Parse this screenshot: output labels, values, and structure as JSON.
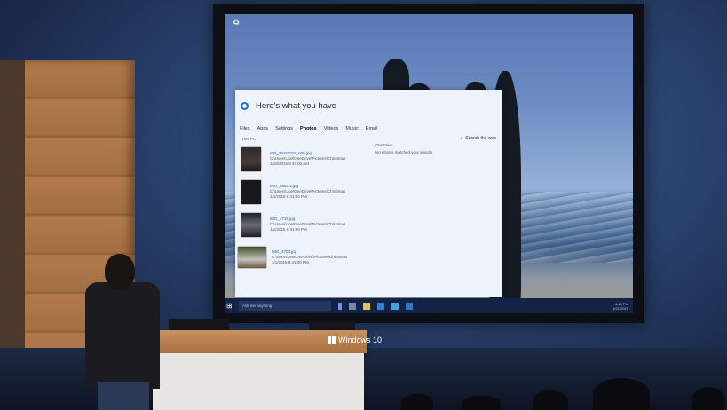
{
  "desktop": {
    "icon_label": "Recycle Bin"
  },
  "search_panel": {
    "title": "Here's what you have",
    "tabs": [
      "Files",
      "Apps",
      "Settings",
      "Photos",
      "Videos",
      "Music",
      "Email"
    ],
    "active_tab": "Photos",
    "search_web_label": "Search the web",
    "this_pc_label": "This PC",
    "onedrive_label": "OneDrive",
    "onedrive_empty": "No photos matched your search.",
    "results": [
      {
        "name": "WP_20150318_026.jpg",
        "path": "C:\\Users\\Joe\\OneDrive\\Pictures\\Christmas",
        "date": "1/18/2015 8:40:00 AM"
      },
      {
        "name": "IMG_0563.2.jpg",
        "path": "C:\\Users\\Joe\\OneDrive\\Pictures\\Christmas",
        "date": "1/1/2015 8:41:00 PM"
      },
      {
        "name": "IMG_4719.jpg",
        "path": "C:\\Users\\Joe\\OneDrive\\Pictures\\Christmas",
        "date": "1/1/2015 8:41:00 PM"
      },
      {
        "name": "IMG_4700.jpg",
        "path": "C:\\Users\\Joe\\OneDrive\\Pictures\\Christmas",
        "date": "1/1/2015 8:41:00 PM"
      }
    ]
  },
  "taskbar": {
    "search_placeholder": "Ask me anything",
    "time": "4:40 PM",
    "date": "1/21/2015"
  },
  "podium": {
    "brand": "Windows 10"
  }
}
